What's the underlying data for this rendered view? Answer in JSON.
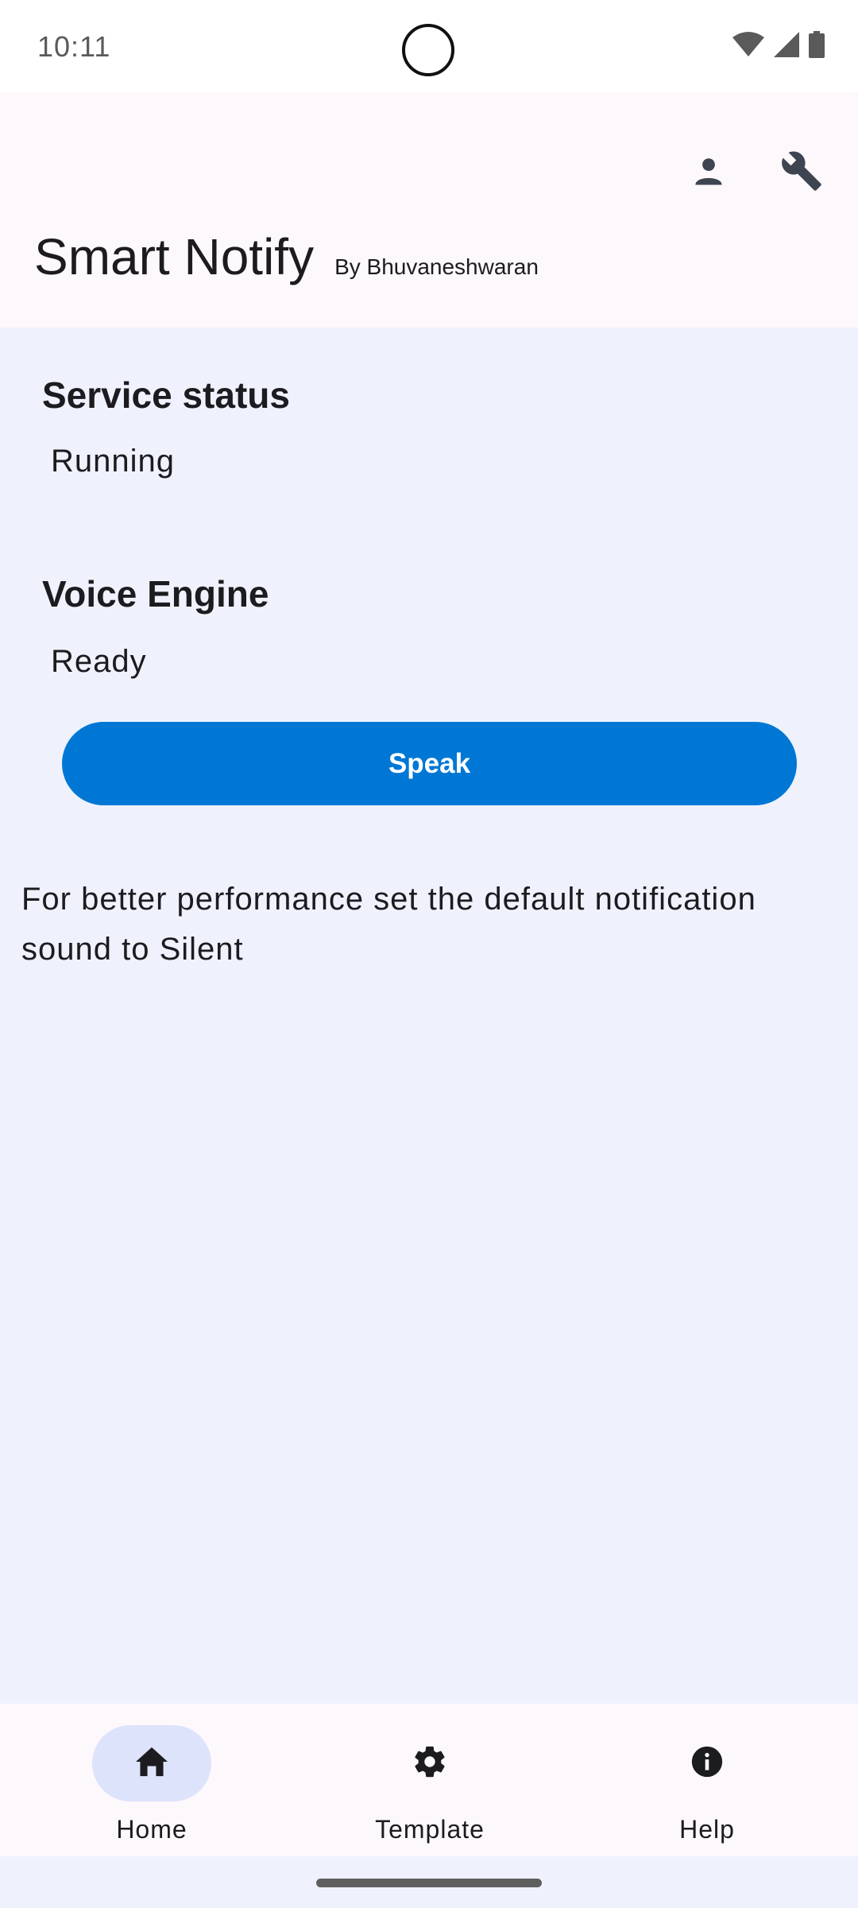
{
  "status_bar": {
    "time": "10:11",
    "icons": [
      "wifi-icon",
      "cell-signal-icon",
      "battery-icon"
    ]
  },
  "app_bar": {
    "title": "Smart Notify",
    "subtitle": "By Bhuvaneshwaran",
    "actions": [
      "person-icon",
      "wrench-icon"
    ]
  },
  "service": {
    "title": "Service status",
    "value": "Running"
  },
  "voice_engine": {
    "title": "Voice Engine",
    "value": "Ready"
  },
  "speak_button": {
    "label": "Speak"
  },
  "tip": {
    "text": "For better performance set the default notification sound to Silent"
  },
  "bottom_nav": {
    "items": [
      {
        "label": "Home",
        "icon": "home-icon",
        "active": true
      },
      {
        "label": "Template",
        "icon": "gear-icon",
        "active": false
      },
      {
        "label": "Help",
        "icon": "info-icon",
        "active": false
      }
    ]
  },
  "colors": {
    "accent": "#0077d4",
    "content_bg": "#eff2fc",
    "app_bar_bg": "#fdf8fc",
    "nav_active_bg": "#dde3fb"
  }
}
